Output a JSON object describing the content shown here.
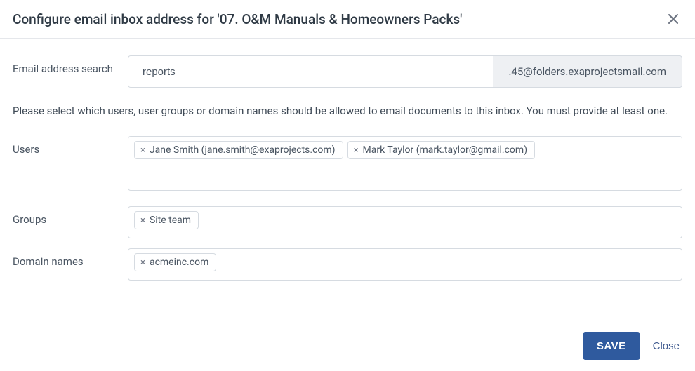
{
  "header": {
    "title": "Configure email inbox address for '07. O&M Manuals & Homeowners Packs'"
  },
  "email_search": {
    "label": "Email address search",
    "value": "reports",
    "suffix": ".45@folders.exaprojectsmail.com"
  },
  "help_text": "Please select which users, user groups or domain names should be allowed to email documents to this inbox. You must provide at least one.",
  "users": {
    "label": "Users",
    "tags": [
      "Jane Smith (jane.smith@exaprojects.com)",
      "Mark Taylor (mark.taylor@gmail.com)"
    ]
  },
  "groups": {
    "label": "Groups",
    "tags": [
      "Site team"
    ]
  },
  "domains": {
    "label": "Domain names",
    "tags": [
      "acmeinc.com"
    ]
  },
  "footer": {
    "save_label": "SAVE",
    "close_label": "Close"
  },
  "glyphs": {
    "tag_remove": "×"
  }
}
